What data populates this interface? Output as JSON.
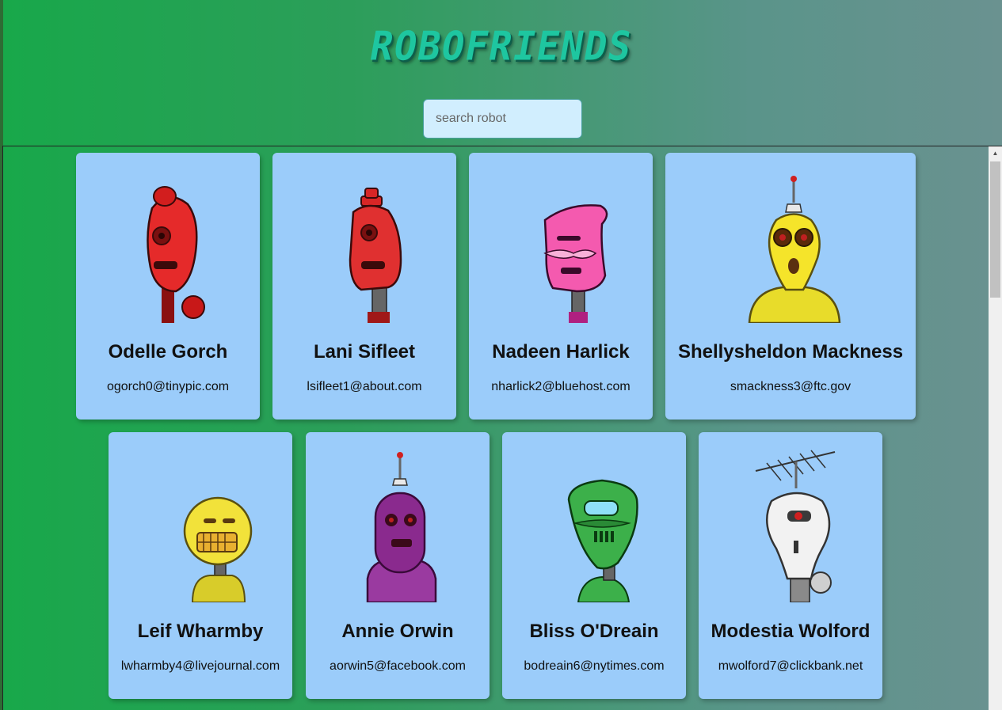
{
  "app": {
    "title": "ROBOFRIENDS"
  },
  "search": {
    "placeholder": "search robot",
    "value": ""
  },
  "robots": [
    {
      "name": "Odelle Gorch",
      "email": "ogorch0@tinypic.com",
      "color": "#e52a2a",
      "icon": "red-robot-avatar"
    },
    {
      "name": "Lani Sifleet",
      "email": "lsifleet1@about.com",
      "color": "#e03030",
      "icon": "red-robot-avatar"
    },
    {
      "name": "Nadeen Harlick",
      "email": "nharlick2@bluehost.com",
      "color": "#f45aaf",
      "icon": "pink-robot-avatar"
    },
    {
      "name": "Shellysheldon Mackness",
      "email": "smackness3@ftc.gov",
      "color": "#f5e42a",
      "icon": "yellow-robot-avatar"
    },
    {
      "name": "Leif Wharmby",
      "email": "lwharmby4@livejournal.com",
      "color": "#f2e23a",
      "icon": "yellow-robot-avatar"
    },
    {
      "name": "Annie Orwin",
      "email": "aorwin5@facebook.com",
      "color": "#8a2a8e",
      "icon": "purple-robot-avatar"
    },
    {
      "name": "Bliss O'Dreain",
      "email": "bodreain6@nytimes.com",
      "color": "#3cb04a",
      "icon": "green-robot-avatar"
    },
    {
      "name": "Modestia Wolford",
      "email": "mwolford7@clickbank.net",
      "color": "#f2f2f2",
      "icon": "white-robot-avatar"
    }
  ]
}
